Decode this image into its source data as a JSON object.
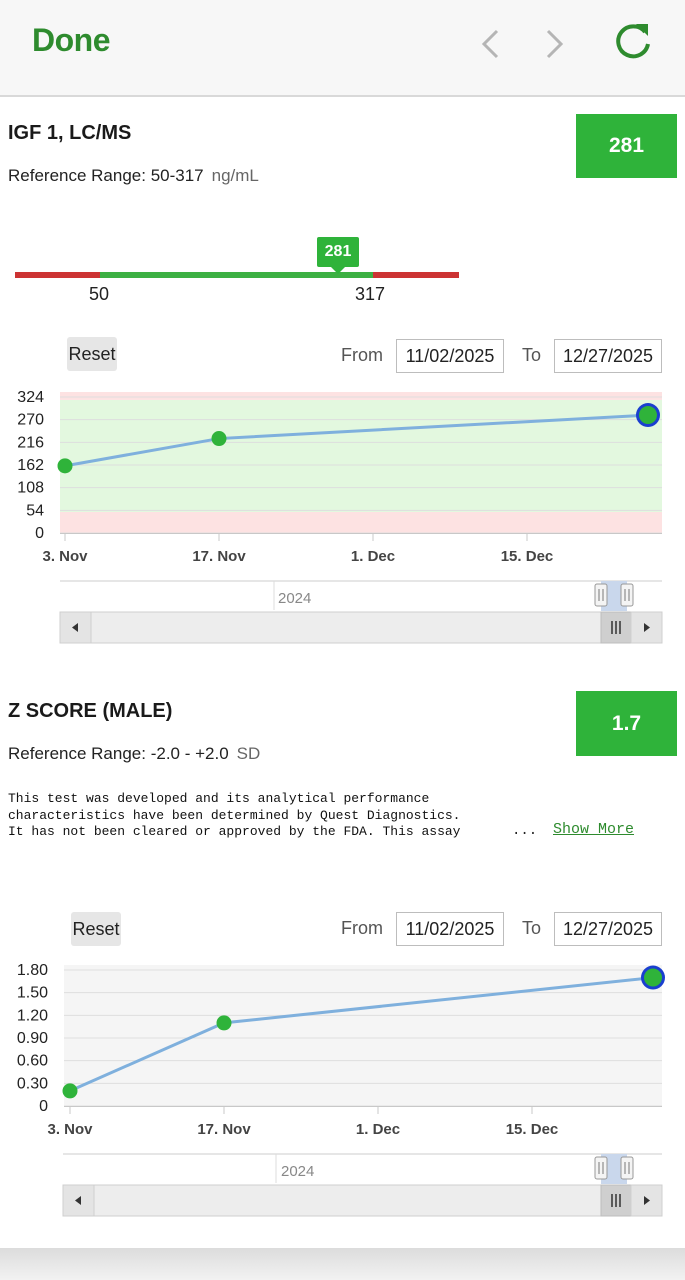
{
  "header": {
    "done_label": "Done",
    "back_icon": "chevron-left-icon",
    "forward_icon": "chevron-right-icon",
    "refresh_icon": "refresh-icon",
    "accent_color": "#2e8b2e"
  },
  "tests": [
    {
      "title": "IGF 1, LC/MS",
      "reference_label": "Reference Range: 50-317",
      "unit": "ng/mL",
      "value": "281",
      "range_bar": {
        "low": "50",
        "high": "317",
        "marker_value": "281",
        "in_range_color": "#3cb043",
        "out_of_range_color": "#cc3333"
      },
      "controls": {
        "reset_label": "Reset",
        "from_label": "From",
        "from_value": "11/02/2025",
        "to_label": "To",
        "to_value": "12/27/2025"
      },
      "navigator": {
        "year_label": "2024",
        "left_arrow_icon": "triangle-left-icon",
        "right_arrow_icon": "triangle-right-icon",
        "grip_icon": "grip-icon"
      }
    },
    {
      "title": "Z SCORE (MALE)",
      "reference_label": "Reference Range: -2.0 - +2.0",
      "unit": "SD",
      "value": "1.7",
      "disclaimer_lines": [
        "This test was developed and its analytical performance",
        "characteristics have been determined by Quest Diagnostics.",
        "It has not been cleared or approved by the FDA. This assay"
      ],
      "ellipsis": "...",
      "show_more_label": "Show More",
      "controls": {
        "reset_label": "Reset",
        "from_label": "From",
        "from_value": "11/02/2025",
        "to_label": "To",
        "to_value": "12/27/2025"
      },
      "navigator": {
        "year_label": "2024",
        "left_arrow_icon": "triangle-left-icon",
        "right_arrow_icon": "triangle-right-icon",
        "grip_icon": "grip-icon"
      }
    }
  ],
  "chart_data": [
    {
      "type": "line",
      "x_tick_labels": [
        "3. Nov",
        "17. Nov",
        "1. Dec",
        "15. Dec"
      ],
      "x": [
        "2024-11-03",
        "2024-11-17",
        "2024-12-26"
      ],
      "y_tick_labels": [
        "324",
        "270",
        "216",
        "162",
        "108",
        "54",
        "0"
      ],
      "ylim": [
        0,
        324
      ],
      "series": [
        {
          "values": [
            160,
            225,
            281
          ],
          "color": "#7fb0dd"
        }
      ],
      "bands": [
        {
          "from": 50,
          "to": 317,
          "color": "#e3f8df"
        },
        {
          "from": 0,
          "to": 50,
          "color": "#fde2e2"
        },
        {
          "from": 317,
          "to": 324,
          "color": "#fde2e2"
        }
      ],
      "point_color": "#2fb33a",
      "highlight_color": "#1a3fcf",
      "grid": true
    },
    {
      "type": "line",
      "x_tick_labels": [
        "3. Nov",
        "17. Nov",
        "1. Dec",
        "15. Dec"
      ],
      "x": [
        "2024-11-03",
        "2024-11-17",
        "2024-12-26"
      ],
      "y_tick_labels": [
        "1.80",
        "1.50",
        "1.20",
        "0.90",
        "0.60",
        "0.30",
        "0"
      ],
      "ylim": [
        0,
        1.8
      ],
      "series": [
        {
          "values": [
            0.2,
            1.1,
            1.7
          ],
          "color": "#7fb0dd"
        }
      ],
      "point_color": "#2fb33a",
      "highlight_color": "#1a3fcf",
      "grid": true
    }
  ]
}
